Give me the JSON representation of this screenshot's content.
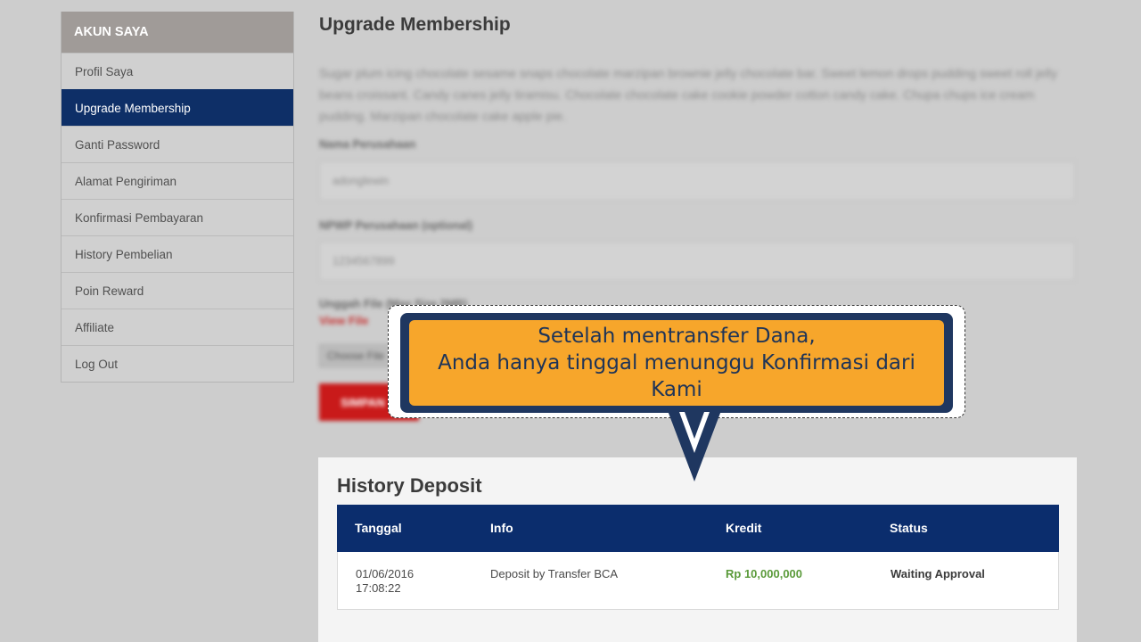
{
  "sidebar": {
    "heading": "AKUN SAYA",
    "items": [
      {
        "label": "Profil Saya"
      },
      {
        "label": "Upgrade Membership"
      },
      {
        "label": "Ganti Password"
      },
      {
        "label": "Alamat Pengiriman"
      },
      {
        "label": "Konfirmasi Pembayaran"
      },
      {
        "label": "History Pembelian"
      },
      {
        "label": "Poin Reward"
      },
      {
        "label": "Affiliate"
      },
      {
        "label": "Log Out"
      }
    ],
    "active_index": 1
  },
  "main": {
    "title": "Upgrade Membership",
    "description": "Sugar plum icing chocolate sesame snaps chocolate marzipan brownie jelly chocolate bar. Sweet lemon drops pudding sweet roll jelly beans croissant. Candy canes jelly tiramisu. Chocolate chocolate cake cookie powder cotton candy cake. Chupa chups ice cream pudding. Marzipan chocolate cake apple pie.",
    "company_name_label": "Nama Perusahaan",
    "company_name_value": "adonglewin",
    "npwp_label": "NPWP Perusahaan (optional)",
    "npwp_value": "1234567899",
    "upload_label": "Unggah File (Max Size 2MB)",
    "view_file": "View File",
    "choose_file": "Choose File",
    "save_button": "SIMPAN"
  },
  "callout": {
    "line1": "Setelah mentransfer Dana,",
    "line2": "Anda hanya tinggal menunggu Konfirmasi dari Kami"
  },
  "history_deposit": {
    "title": "History Deposit",
    "columns": [
      "Tanggal",
      "Info",
      "Kredit",
      "Status"
    ],
    "rows": [
      {
        "date": "01/06/2016",
        "time": "17:08:22",
        "info": "Deposit by Transfer BCA",
        "kredit": "Rp 10,000,000",
        "status": "Waiting Approval"
      }
    ]
  },
  "colors": {
    "navy": "#0b2d6d",
    "active_sidebar": "#0e2f67",
    "callout_orange": "#f7a62b",
    "amount_green": "#5a9a3a",
    "save_red": "#c91a1a"
  }
}
